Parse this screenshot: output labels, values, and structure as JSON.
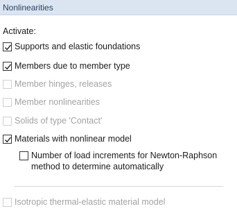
{
  "header": {
    "title": "Nonlinearities"
  },
  "section": {
    "label": "Activate:"
  },
  "options": {
    "supports": {
      "label": "Supports and elastic foundations",
      "checked": true,
      "enabled": true
    },
    "members": {
      "label": "Members due to member type",
      "checked": true,
      "enabled": true
    },
    "hinges": {
      "label": "Member hinges, releases",
      "checked": false,
      "enabled": false
    },
    "member_nonlin": {
      "label": "Member nonlinearities",
      "checked": false,
      "enabled": false
    },
    "solids": {
      "label": "Solids of type 'Contact'",
      "checked": false,
      "enabled": false
    },
    "materials": {
      "label": "Materials with nonlinear model",
      "checked": true,
      "enabled": true
    },
    "load_increments": {
      "line1": "Number of load increments for Newton-Raphson",
      "line2": "method to determine automatically",
      "checked": false,
      "enabled": true
    },
    "isotropic": {
      "label": "Isotropic thermal-elastic material model",
      "checked": false,
      "enabled": false
    }
  },
  "colors": {
    "header_bg": "#dbe5f1",
    "disabled_text": "#a3a3a3",
    "text": "#1b1b1b"
  }
}
